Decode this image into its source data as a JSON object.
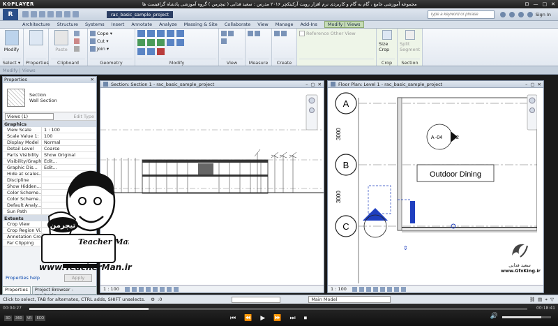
{
  "player": {
    "logo": "K✿PLAYER",
    "title": "مجموعه آموزشی جامع ، گام به گام و کاربردی نرم افزار رویت آرکیتکچر ۲۰۱۶ مدرس : سعید فدایی ( تیچرمن ) گروه آموزشی پادشاه گرافیست ها",
    "win_controls": [
      "⊡",
      "—",
      "□",
      "✕"
    ]
  },
  "app": {
    "logo": "R",
    "doc_title": "rac_basic_sample_project",
    "search_placeholder": "Type a keyword or phrase",
    "signin": "Sign In"
  },
  "tabs": [
    "Architecture",
    "Structure",
    "Systems",
    "Insert",
    "Annotate",
    "Analyze",
    "Massing & Site",
    "Collaborate",
    "View",
    "Manage",
    "Add-Ins",
    "Modify | Views"
  ],
  "active_tab_index": 11,
  "ribbon": {
    "groups": [
      {
        "label": "Select ▾",
        "buttons": [
          "Modify"
        ]
      },
      {
        "label": "Properties",
        "buttons": []
      },
      {
        "label": "Clipboard",
        "buttons": [
          "Paste"
        ]
      },
      {
        "label": "Geometry",
        "small": [
          "Cope ▾",
          "Cut ▾",
          "Join ▾"
        ]
      },
      {
        "label": "Modify",
        "buttons": []
      },
      {
        "label": "View",
        "buttons": []
      },
      {
        "label": "Measure",
        "buttons": []
      },
      {
        "label": "Create",
        "buttons": []
      },
      {
        "label": "",
        "small": [
          "Reference Other View"
        ]
      },
      {
        "label": "Crop",
        "buttons": [
          "Size Crop"
        ]
      },
      {
        "label": "Section",
        "buttons": [
          "Split Segment"
        ]
      }
    ]
  },
  "subbar": {
    "context": "Modify | Views"
  },
  "properties": {
    "title": "Properties",
    "type_name": "Section",
    "type_sub": "Wall Section",
    "views_selector": "Views (1)",
    "edit_type": "Edit Type",
    "section_graphics": "Graphics",
    "section_extents": "Extents",
    "rows": [
      [
        "View Scale",
        "1 : 100"
      ],
      [
        "Scale Value  1:",
        "100"
      ],
      [
        "Display Model",
        "Normal"
      ],
      [
        "Detail Level",
        "Coarse"
      ],
      [
        "Parts Visibility",
        "Show Original"
      ],
      [
        "Visibility/Graph...",
        "Edit..."
      ],
      [
        "Graphic Dis...",
        "Edit..."
      ],
      [
        "Hide at scales...",
        ""
      ],
      [
        "Discipline",
        ""
      ],
      [
        "Show Hidden...",
        ""
      ],
      [
        "Color Scheme...",
        ""
      ],
      [
        "Color Scheme...",
        ""
      ],
      [
        "Default Analy...",
        ""
      ],
      [
        "Sun Path",
        ""
      ]
    ],
    "extent_rows": [
      [
        "Crop View",
        ""
      ],
      [
        "Crop Region Vi...",
        ""
      ],
      [
        "Annotation Crop",
        ""
      ],
      [
        "Far Clipping",
        ""
      ]
    ],
    "help": "Properties help",
    "apply": "Apply"
  },
  "bottom_tabs": [
    "Properties",
    "Project Browser - rac_basic_..."
  ],
  "view_section": {
    "title": "Section: Section 1 - rac_basic_sample_project",
    "scale": "1 : 100"
  },
  "view_plan": {
    "title": "Floor Plan: Level 1 - rac_basic_sample_project",
    "scale": "1 : 100",
    "grid_labels": [
      "A",
      "B",
      "C"
    ],
    "dims": [
      "3000",
      "3000"
    ],
    "tag": "A -04",
    "tag_num": "2",
    "room": "Outdoor Dining"
  },
  "status": {
    "hint": "Click to select, TAB for alternates, CTRL adds, SHIFT unselects.",
    "model": "Main Model",
    "zero": ":0"
  },
  "playback": {
    "elapsed": "00:04:27",
    "total": "00:18:41",
    "progress": 0.24,
    "volume": 0.8,
    "left_buttons": [
      "3D",
      "360",
      "VR",
      "ECO"
    ]
  },
  "overlay": {
    "watermark_url": "www.TeacherMan.ir",
    "cartoon_brand": "Teacher Man",
    "gfx_name": "سعید فدایی",
    "gfx_url": "www.GfxKing.ir"
  },
  "colors": {
    "accent": "#2a4f8a",
    "ctx_tab": "#c6dcb6",
    "tag_blue": "#1f3fbf"
  }
}
